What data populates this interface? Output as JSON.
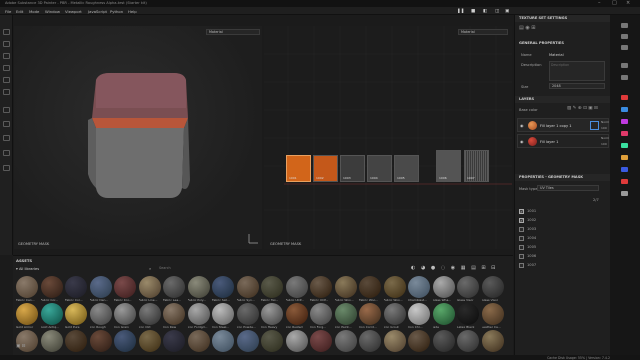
{
  "app": {
    "title": "Adobe Substance 3D Painter - PBR - Metallic Roughness Alpha-test (Starter kit)"
  },
  "menu": [
    "File",
    "Edit",
    "Mode",
    "Window",
    "Viewport",
    "JavaScript",
    "Python",
    "Help"
  ],
  "viewport3d": {
    "material_mode": "Material",
    "mask_label": "GEOMETRY MASK"
  },
  "viewport2d": {
    "material_mode": "Material",
    "mask_label": "GEOMETRY MASK",
    "tiles": [
      "1001",
      "1002",
      "1003",
      "1004",
      "1005",
      "1006",
      "1007"
    ]
  },
  "texture_set_settings": {
    "header": "TEXTURE SET SETTINGS",
    "general_header": "GENERAL PROPERTIES",
    "name_label": "Name",
    "name_value": "Material",
    "description_label": "Description",
    "description_placeholder": "Description",
    "size_label": "Size",
    "size_value": "2048"
  },
  "layers": {
    "header": "LAYERS",
    "channel": "Base color",
    "items": [
      {
        "name": "Fill layer 1 copy 1",
        "blend": "Norm",
        "opacity": "100"
      },
      {
        "name": "Fill layer 1",
        "blend": "Norm",
        "opacity": "100"
      }
    ]
  },
  "properties": {
    "header": "PROPERTIES - GEOMETRY MASK",
    "mask_type_label": "Mask type",
    "mask_type_value": "UV Tiles",
    "count": "2/7",
    "tiles": [
      {
        "id": "1001",
        "checked": true
      },
      {
        "id": "1002",
        "checked": true
      },
      {
        "id": "1003",
        "checked": false
      },
      {
        "id": "1004",
        "checked": false
      },
      {
        "id": "1005",
        "checked": false
      },
      {
        "id": "1006",
        "checked": false
      },
      {
        "id": "1007",
        "checked": false
      }
    ]
  },
  "assets": {
    "header": "ASSETS",
    "library": "All libraries",
    "search_placeholder": "Search",
    "row1": [
      "Fabric Can...",
      "Fabric Cor...",
      "Fabric Cor...",
      "Fabric Den...",
      "Fabric Kni...",
      "Fabric Line...",
      "Fabric Lea...",
      "Fabric Poly...",
      "Fabric Sat...",
      "Fabric Syn...",
      "Fabric Twi...",
      "Fabric UCP...",
      "Fabric UCP...",
      "Fabric Woo...",
      "Fabric Woo...",
      "Fabric Woo...",
      "Chamblast...",
      "Glass Wha...",
      "Glass Visor",
      "Glass Visor"
    ],
    "row2": [
      "Gold Armor",
      "Gold Antiq...",
      "Gold Pure",
      "Iron Rough",
      "Iron Grain",
      "Iron Old",
      "Iron Raw",
      "Iron Fordgd...",
      "Iron Steel...",
      "Iron Powde...",
      "Iron Heavy",
      "Iron Rusted",
      "Iron Forg...",
      "Iron Paint...",
      "Iron Corrd...",
      "Iron Grout",
      "Iron Chr...",
      "Jade",
      "Latex Black",
      "Leather Ca..."
    ],
    "row3": [
      "",
      "",
      "",
      "",
      "",
      "",
      "",
      "",
      "",
      "",
      "",
      "",
      "",
      "",
      "",
      "",
      "",
      "",
      "",
      ""
    ]
  },
  "status": {
    "text": "Cache Disk Usage: 55% | Version: 7.4.2"
  },
  "colors": {
    "accent": "#e07a1f",
    "selected_tile": "#d2651a",
    "cube_top": "#b8563a"
  }
}
